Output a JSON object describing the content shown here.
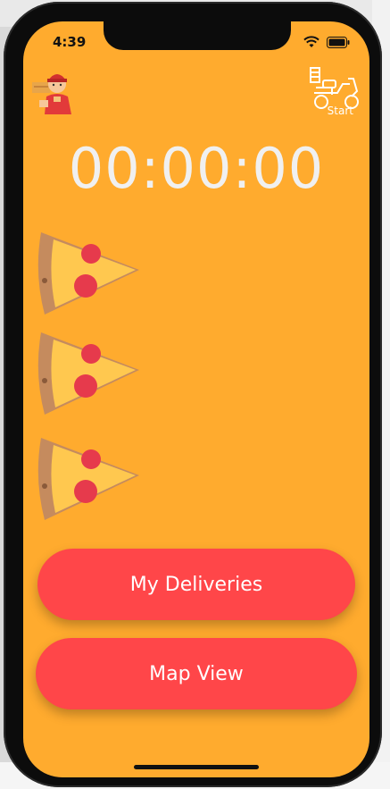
{
  "status_bar": {
    "time": "4:39"
  },
  "header": {
    "start_label": "Start"
  },
  "timer": {
    "value": "00:00:00"
  },
  "pizzas": [
    {
      "name": "pizza-slice-1"
    },
    {
      "name": "pizza-slice-2"
    },
    {
      "name": "pizza-slice-3"
    }
  ],
  "actions": {
    "my_deliveries": "My Deliveries",
    "map_view": "Map View"
  },
  "colors": {
    "background": "#ffab2e",
    "button": "#ff4649",
    "timer_text": "#f0f0f0"
  },
  "icons": [
    "courier-icon",
    "scooter-icon",
    "wifi-icon",
    "battery-icon"
  ]
}
